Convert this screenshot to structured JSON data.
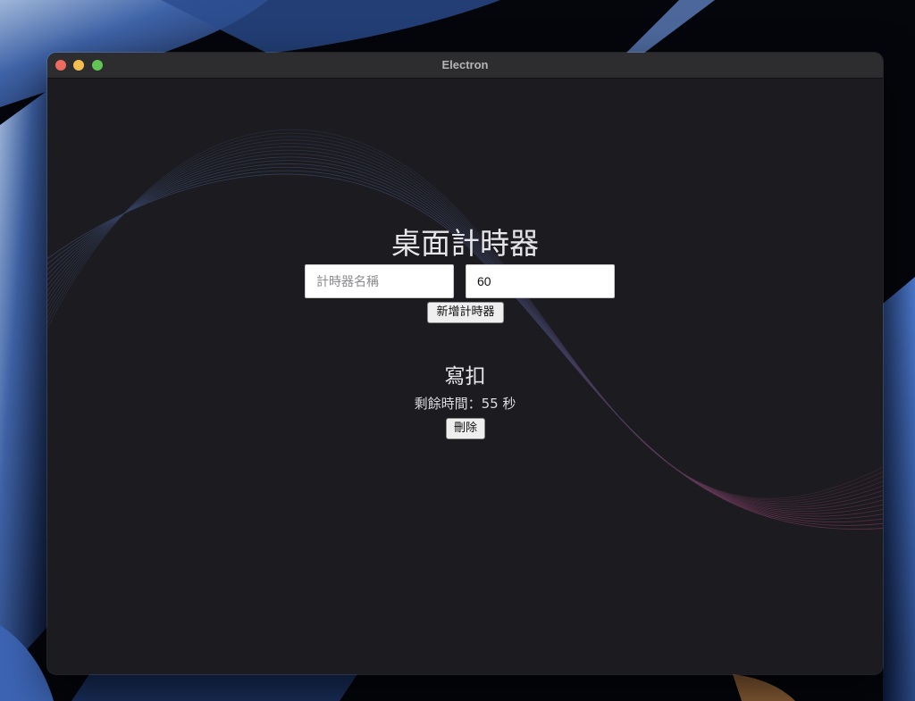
{
  "window": {
    "title": "Electron"
  },
  "app": {
    "heading": "桌面計時器",
    "name_input": {
      "placeholder": "計時器名稱",
      "value": ""
    },
    "seconds_input": {
      "value": "60"
    },
    "add_button_label": "新增計時器",
    "timers": [
      {
        "name": "寫扣",
        "remaining_label": "剩餘時間：55 秒",
        "delete_label": "刪除"
      }
    ]
  },
  "colors": {
    "window_background": "#1c1c20",
    "titlebar": "#2d2d30",
    "close": "#ed6a5e",
    "minimize": "#f5bf4f",
    "zoom": "#61c554",
    "wave_start": "#3b4f7a",
    "wave_end": "#8e3a5e"
  }
}
